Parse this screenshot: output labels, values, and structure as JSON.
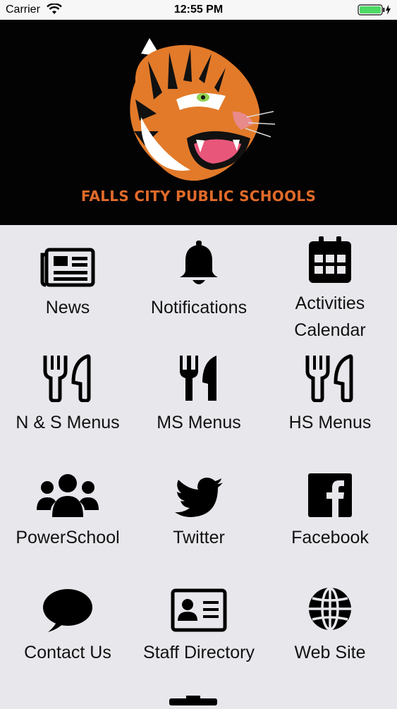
{
  "status": {
    "carrier": "Carrier",
    "time": "12:55 PM"
  },
  "header": {
    "brand": "FALLS CITY PUBLIC SCHOOLS",
    "colors": {
      "background": "#030303",
      "brand": "#e06a2a"
    }
  },
  "tiles": [
    {
      "label": "News",
      "icon": "newspaper-icon"
    },
    {
      "label": "Notifications",
      "icon": "bell-icon"
    },
    {
      "label": "Activities Calendar",
      "icon": "calendar-icon"
    },
    {
      "label": "N & S Menus",
      "icon": "utensils-icon"
    },
    {
      "label": "MS Menus",
      "icon": "utensils-icon"
    },
    {
      "label": "HS Menus",
      "icon": "utensils-icon"
    },
    {
      "label": "PowerSchool",
      "icon": "users-icon"
    },
    {
      "label": "Twitter",
      "icon": "twitter-icon"
    },
    {
      "label": "Facebook",
      "icon": "facebook-icon"
    },
    {
      "label": "Contact Us",
      "icon": "speech-bubble-icon"
    },
    {
      "label": "Staff Directory",
      "icon": "id-card-icon"
    },
    {
      "label": "Web Site",
      "icon": "globe-icon"
    }
  ]
}
